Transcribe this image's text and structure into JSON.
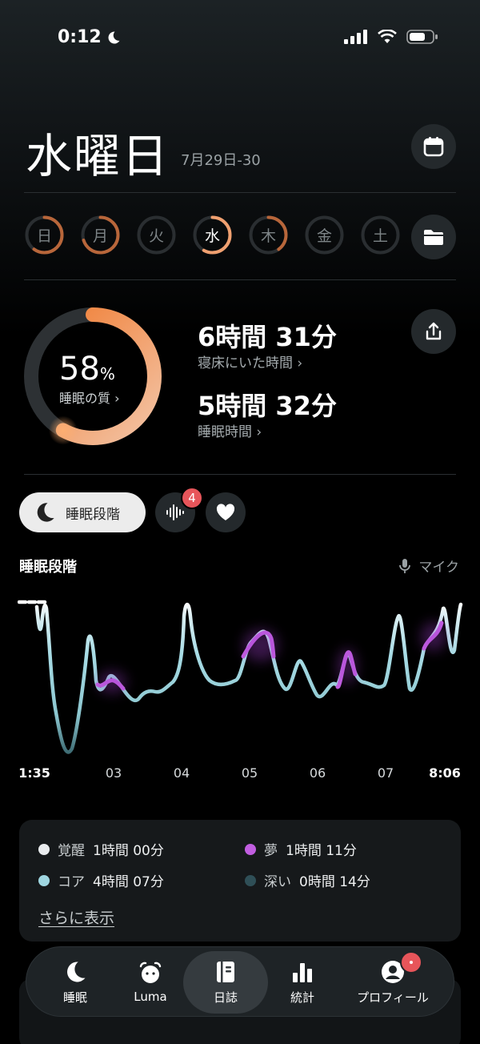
{
  "status_bar": {
    "time": "0:12"
  },
  "header": {
    "day": "水曜日",
    "date_range": "7月29日-30"
  },
  "week": [
    {
      "label": "日",
      "progress": 0.6
    },
    {
      "label": "月",
      "progress": 0.7
    },
    {
      "label": "火",
      "progress": 0
    },
    {
      "label": "水",
      "progress": 0.58,
      "active": true
    },
    {
      "label": "木",
      "progress": 0.4
    },
    {
      "label": "金",
      "progress": 0
    },
    {
      "label": "土",
      "progress": 0
    }
  ],
  "quality": {
    "percent": "58",
    "percent_unit": "%",
    "label": "睡眠の質 ›",
    "value": 0.58
  },
  "stats": {
    "in_bed_time": "6時間 31分",
    "in_bed_label": "寝床にいた時間 ›",
    "sleep_time": "5時間 32分",
    "sleep_label": "睡眠時間 ›"
  },
  "tabs": {
    "sleep_phases": "睡眠段階",
    "sound_badge": "4"
  },
  "chart_section": {
    "title": "睡眠段階",
    "mic_label": "マイク"
  },
  "chart_data": {
    "type": "line",
    "x_ticks": [
      "1:35",
      "03",
      "04",
      "05",
      "06",
      "07",
      "8:06"
    ],
    "y_levels": [
      "覚醒",
      "夢",
      "コア",
      "深い"
    ]
  },
  "legend": [
    {
      "name": "覚醒",
      "value": "1時間 00分",
      "color": "#e9ecee"
    },
    {
      "name": "夢",
      "value": "1時間 11分",
      "color": "#c15ee0"
    },
    {
      "name": "コア",
      "value": "4時間 07分",
      "color": "#9fd6e0"
    },
    {
      "name": "深い",
      "value": "0時間 14分",
      "color": "#2f4f57"
    }
  ],
  "show_more": "さらに表示",
  "nav": [
    {
      "label": "睡眠",
      "icon": "moon-icon"
    },
    {
      "label": "Luma",
      "icon": "alarm-icon"
    },
    {
      "label": "日誌",
      "icon": "journal-icon",
      "active": true
    },
    {
      "label": "統計",
      "icon": "chart-icon"
    },
    {
      "label": "プロフィール",
      "icon": "profile-icon"
    }
  ]
}
